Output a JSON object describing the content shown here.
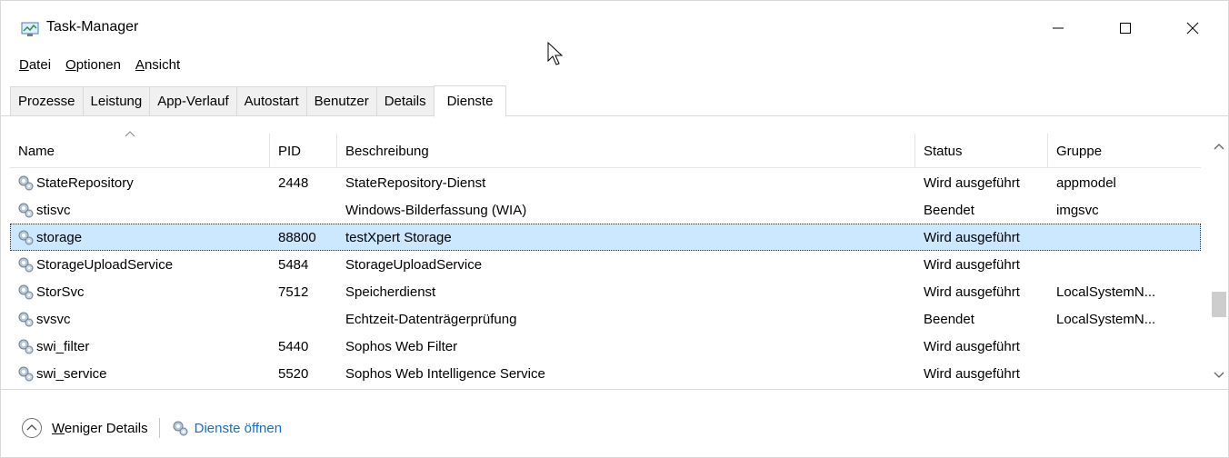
{
  "window": {
    "title": "Task-Manager"
  },
  "menu": [
    {
      "label": "Datei",
      "u": "D",
      "rest": "atei"
    },
    {
      "label": "Optionen",
      "u": "O",
      "rest": "ptionen"
    },
    {
      "label": "Ansicht",
      "u": "A",
      "rest": "nsicht"
    }
  ],
  "tabs": [
    "Prozesse",
    "Leistung",
    "App-Verlauf",
    "Autostart",
    "Benutzer",
    "Details",
    "Dienste"
  ],
  "active_tab": "Dienste",
  "table": {
    "columns": [
      "Name",
      "PID",
      "Beschreibung",
      "Status",
      "Gruppe"
    ],
    "rows": [
      {
        "name": "StateRepository",
        "pid": "2448",
        "desc": "StateRepository-Dienst",
        "status": "Wird ausgeführt",
        "group": "appmodel"
      },
      {
        "name": "stisvc",
        "pid": "",
        "desc": "Windows-Bilderfassung (WIA)",
        "status": "Beendet",
        "group": "imgsvc"
      },
      {
        "name": "storage",
        "pid": "88800",
        "desc": "testXpert Storage",
        "status": "Wird ausgeführt",
        "group": ""
      },
      {
        "name": "StorageUploadService",
        "pid": "5484",
        "desc": "StorageUploadService",
        "status": "Wird ausgeführt",
        "group": ""
      },
      {
        "name": "StorSvc",
        "pid": "7512",
        "desc": "Speicherdienst",
        "status": "Wird ausgeführt",
        "group": "LocalSystemN..."
      },
      {
        "name": "svsvc",
        "pid": "",
        "desc": "Echtzeit-Datenträgerprüfung",
        "status": "Beendet",
        "group": "LocalSystemN..."
      },
      {
        "name": "swi_filter",
        "pid": "5440",
        "desc": "Sophos Web Filter",
        "status": "Wird ausgeführt",
        "group": ""
      },
      {
        "name": "swi_service",
        "pid": "5520",
        "desc": "Sophos Web Intelligence Service",
        "status": "Wird ausgeführt",
        "group": ""
      }
    ],
    "selected_row": "storage"
  },
  "footer": {
    "fewer_details_u": "W",
    "fewer_details_rest": "eniger Details",
    "open_services": "Dienste öffnen"
  },
  "colors": {
    "selected_bg": "#cce8ff",
    "link": "#1a6fc4"
  }
}
